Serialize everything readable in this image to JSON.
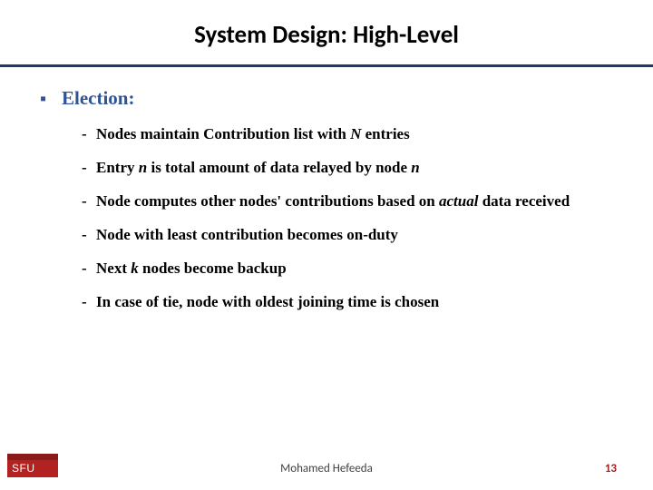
{
  "title": "System Design: High-Level",
  "section": {
    "label": "Election:"
  },
  "items": [
    {
      "pre": "Nodes maintain Contribution list with ",
      "em1": "N",
      "post": " entries"
    },
    {
      "pre": "Entry ",
      "em1": "n",
      "mid": " is total amount of data relayed by node ",
      "em2": "n",
      "post": ""
    },
    {
      "pre": "Node computes other nodes' contributions based on ",
      "em1": "actual",
      "post": " data received"
    },
    {
      "pre": "Node with least contribution becomes on-duty"
    },
    {
      "pre": "Next ",
      "em1": "k",
      "post": " nodes become backup"
    },
    {
      "pre": "In case of tie, node with oldest joining time is chosen"
    }
  ],
  "footer": {
    "author": "Mohamed  Hefeeda",
    "page": "13",
    "logo": "SFU"
  }
}
